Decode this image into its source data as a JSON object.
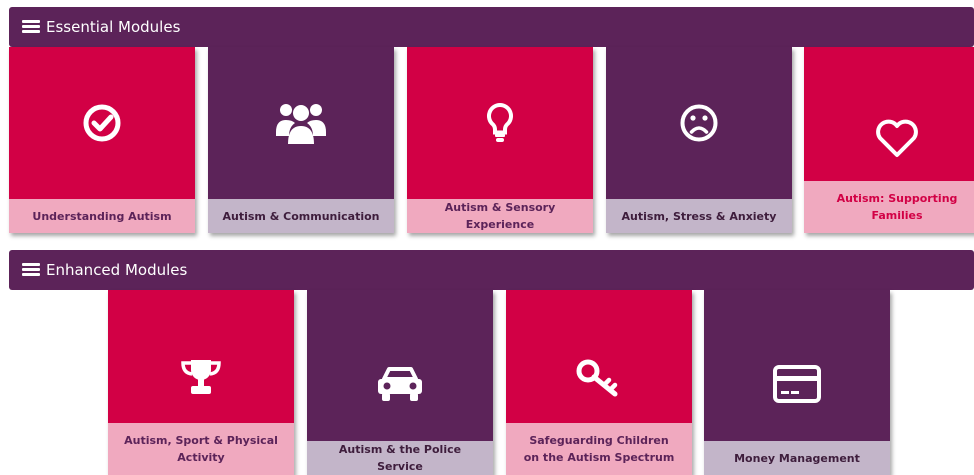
{
  "essential": {
    "title": "Essential Modules",
    "cards": [
      {
        "label": "Understanding Autism",
        "icon": "check-circle-icon"
      },
      {
        "label": "Autism & Communication",
        "icon": "users-icon"
      },
      {
        "label": "Autism & Sensory Experience",
        "icon": "lightbulb-icon"
      },
      {
        "label": "Autism, Stress & Anxiety",
        "icon": "frown-face-icon"
      },
      {
        "label": "Autism: Supporting Families",
        "icon": "heart-icon"
      }
    ]
  },
  "enhanced": {
    "title": "Enhanced Modules",
    "cards": [
      {
        "label": "Autism, Sport & Physical Activity",
        "icon": "trophy-icon"
      },
      {
        "label": "Autism & the Police Service",
        "icon": "car-icon"
      },
      {
        "label": "Safeguarding Children on the Autism Spectrum",
        "icon": "key-icon"
      },
      {
        "label": "Money Management",
        "icon": "credit-card-icon"
      }
    ]
  },
  "colors": {
    "purple": "#5c2359",
    "crimson": "#d20045",
    "pink_label": "#f0a9bf",
    "lilac_label": "#c3b5c9"
  }
}
